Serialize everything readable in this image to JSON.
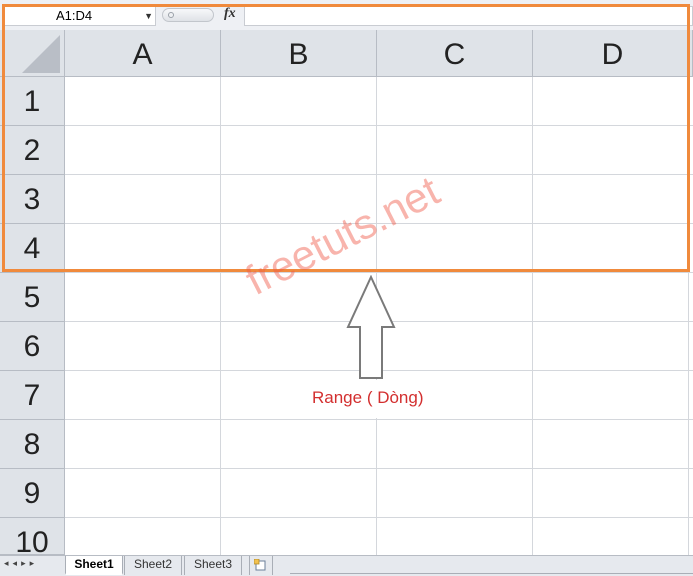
{
  "formula_bar": {
    "name_box": "A1:D4",
    "fx_label": "fx",
    "formula": ""
  },
  "columns": [
    "A",
    "B",
    "C",
    "D"
  ],
  "rows": [
    "1",
    "2",
    "3",
    "4",
    "5",
    "6",
    "7",
    "8",
    "9",
    "10"
  ],
  "annotation": {
    "label": "Range ( Dòng)",
    "color": "#d32f2f"
  },
  "watermark": "freetuts.net",
  "highlight_color": "#f08a3c",
  "sheet_tabs": [
    "Sheet1",
    "Sheet2",
    "Sheet3"
  ],
  "active_sheet": "Sheet1",
  "icons": {
    "dropdown": "chevron-down-icon",
    "new_sheet": "insert-sheet-icon",
    "nav": [
      "first-sheet-icon",
      "prev-sheet-icon",
      "next-sheet-icon",
      "last-sheet-icon"
    ]
  }
}
